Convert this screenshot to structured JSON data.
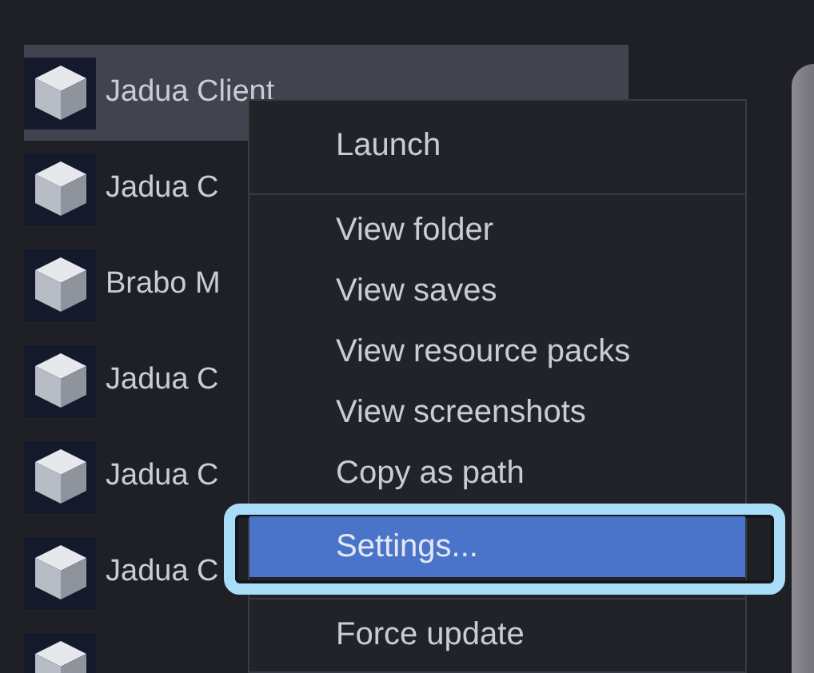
{
  "instances": [
    {
      "name": "Jadua Client",
      "selected": true
    },
    {
      "name": "Jadua C",
      "selected": false
    },
    {
      "name": "Brabo M",
      "selected": false
    },
    {
      "name": "Jadua C",
      "selected": false
    },
    {
      "name": "Jadua C",
      "selected": false
    },
    {
      "name": "Jadua C",
      "selected": false
    },
    {
      "selected": false
    }
  ],
  "context_menu": {
    "items": [
      {
        "kind": "item",
        "label": "Launch",
        "selected": false,
        "highlighted": false
      },
      {
        "kind": "separator"
      },
      {
        "kind": "item",
        "label": "View folder",
        "selected": false,
        "highlighted": false
      },
      {
        "kind": "item",
        "label": "View saves",
        "selected": false,
        "highlighted": false
      },
      {
        "kind": "item",
        "label": "View resource packs",
        "selected": false,
        "highlighted": false
      },
      {
        "kind": "item",
        "label": "View screenshots",
        "selected": false,
        "highlighted": false
      },
      {
        "kind": "item",
        "label": "Copy as path",
        "selected": false,
        "highlighted": false
      },
      {
        "kind": "item",
        "label": "Settings...",
        "selected": true,
        "highlighted": true
      },
      {
        "kind": "separator"
      },
      {
        "kind": "item",
        "label": "Force update",
        "selected": false,
        "highlighted": false
      }
    ]
  }
}
